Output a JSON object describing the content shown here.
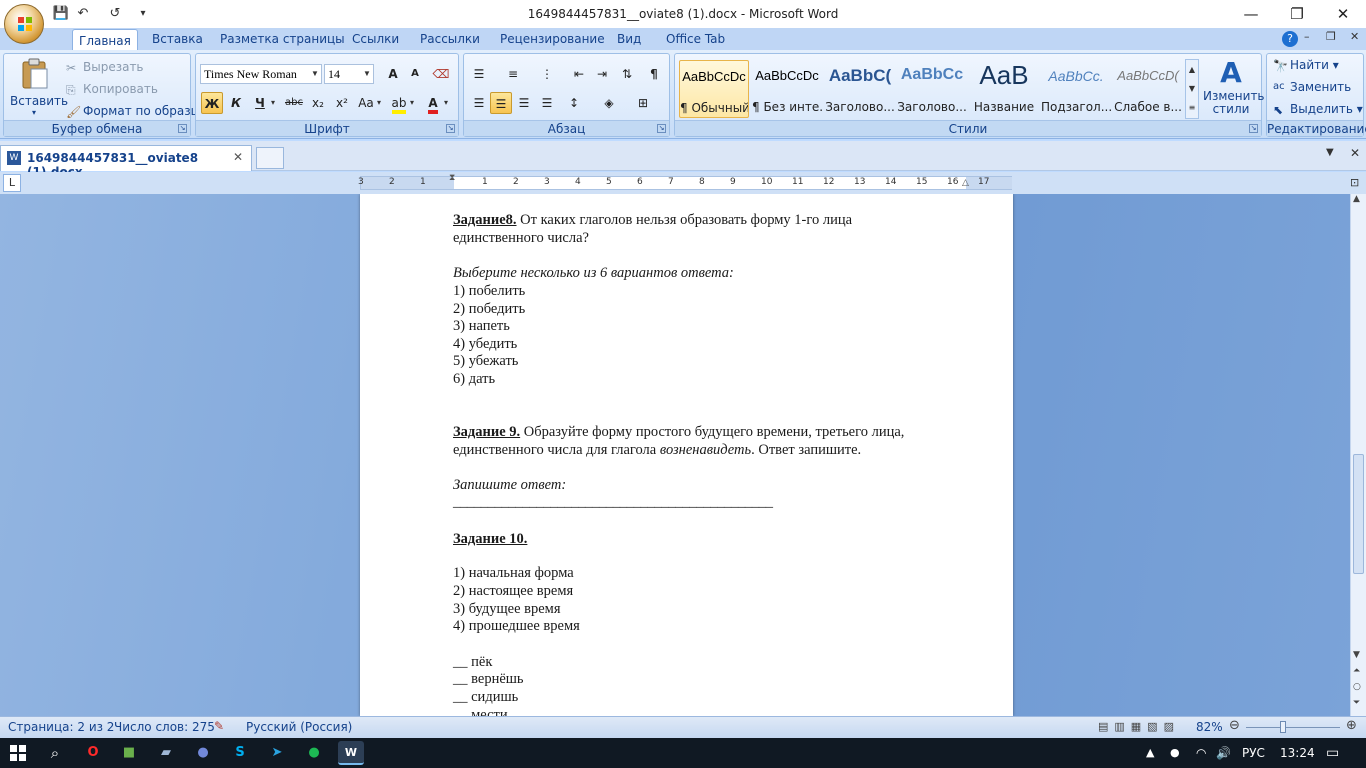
{
  "window": {
    "title": "1649844457831__oviate8 (1).docx - Microsoft Word",
    "minimize": "—",
    "restore": "❐",
    "close": "✕"
  },
  "qat": {
    "save": "💾",
    "undo": "↶",
    "redo": "↺",
    "customize": "▾"
  },
  "tabs": [
    "Главная",
    "Вставка",
    "Разметка страницы",
    "Ссылки",
    "Рассылки",
    "Рецензирование",
    "Вид",
    "Office Tab"
  ],
  "ribbon": {
    "clipboard": {
      "label": "Буфер обмена",
      "paste": "Вставить",
      "cut": "Вырезать",
      "copy": "Копировать",
      "format_painter": "Формат по образцу"
    },
    "font": {
      "label": "Шрифт",
      "font_name": "Times New Roman",
      "font_size": "14",
      "grow": "A",
      "shrink": "A",
      "bold": "Ж",
      "italic": "К",
      "underline": "Ч",
      "strike": "abc",
      "subscript": "x₂",
      "superscript": "x²",
      "case": "Aa",
      "color_a": "A"
    },
    "paragraph": {
      "label": "Абзац"
    },
    "styles": {
      "label": "Стили",
      "items": [
        {
          "sample": "AaBbCcDc",
          "name": "¶ Обычный"
        },
        {
          "sample": "AaBbCcDc",
          "name": "¶ Без инте..."
        },
        {
          "sample": "AaBbC(",
          "name": "Заголово..."
        },
        {
          "sample": "AaBbCc",
          "name": "Заголово..."
        },
        {
          "sample": "AaB",
          "name": "Название"
        },
        {
          "sample": "AaBbCc.",
          "name": "Подзагол..."
        },
        {
          "sample": "AaBbCcD(",
          "name": "Слабое в..."
        }
      ],
      "change_styles": "Изменить стили"
    },
    "editing": {
      "label": "Редактирование",
      "find": "Найти",
      "replace": "Заменить",
      "select": "Выделить"
    }
  },
  "doc_tab": {
    "name": "1649844457831__oviate8 (1).docx",
    "close": "✕"
  },
  "ruler": {
    "marks": [
      "3",
      "2",
      "1",
      "1",
      "2",
      "3",
      "4",
      "5",
      "6",
      "7",
      "8",
      "9",
      "10",
      "11",
      "12",
      "13",
      "14",
      "15",
      "16",
      "17"
    ]
  },
  "document": {
    "task8_title": "Задание8.",
    "task8_text": " От каких глаголов нельзя образовать форму 1-го лица",
    "task8_text2": "единственного числа?",
    "task8_hint": "Выберите несколько из 6 вариантов ответа:",
    "task8_options": [
      "1) побелить",
      "2) победить",
      "3) напеть",
      "4) убедить",
      "5) убежать",
      "6) дать"
    ],
    "task9_title": "Задание 9.",
    "task9_text": " Образуйте форму простого будущего времени, третьего лица,",
    "task9_text2a": "единственного числа для глагола ",
    "task9_word": "возненавидеть",
    "task9_text2b": ". Ответ запишите.",
    "task9_hint": "Запишите ответ:",
    "answer_line": "______________________________________________",
    "task10_title": "Задание 10.",
    "task10_options": [
      "1) начальная форма",
      "2) настоящее время",
      "3) будущее время",
      "4) прошедшее время"
    ],
    "task10_words": [
      "__ пёк",
      "__ вернёшь",
      "__ сидишь",
      "__ мести"
    ]
  },
  "status": {
    "page": "Страница: 2 из 2",
    "words": "Число слов: 275",
    "language": "Русский (Россия)",
    "zoom": "82%"
  },
  "taskbar": {
    "lang": "РУС",
    "time": "13:24"
  }
}
